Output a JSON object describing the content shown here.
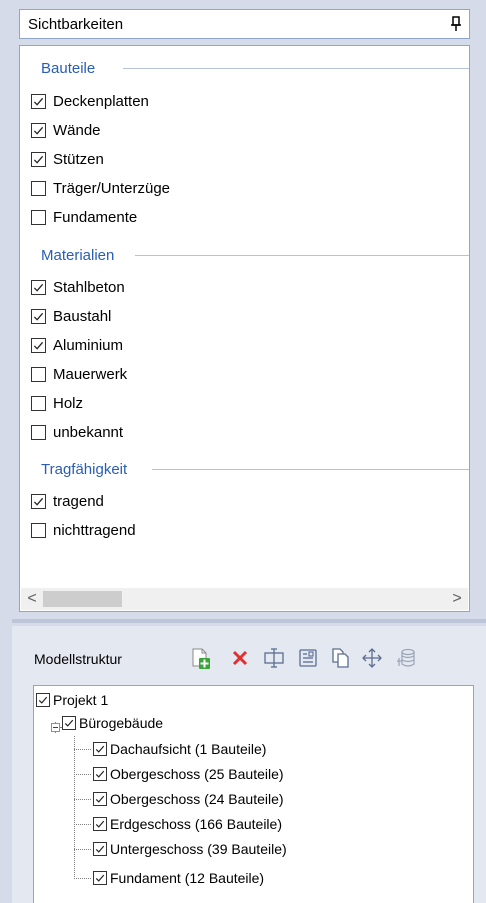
{
  "visibility_panel": {
    "title": "Sichtbarkeiten",
    "pin_icon": "pin-icon",
    "groups": [
      {
        "label": "Bauteile",
        "items": [
          {
            "label": "Deckenplatten",
            "checked": true
          },
          {
            "label": "Wände",
            "checked": true
          },
          {
            "label": "Stützen",
            "checked": true
          },
          {
            "label": "Träger/Unterzüge",
            "checked": false
          },
          {
            "label": "Fundamente",
            "checked": false
          }
        ]
      },
      {
        "label": "Materialien",
        "items": [
          {
            "label": "Stahlbeton",
            "checked": true
          },
          {
            "label": "Baustahl",
            "checked": true
          },
          {
            "label": "Aluminium",
            "checked": true
          },
          {
            "label": "Mauerwerk",
            "checked": false
          },
          {
            "label": "Holz",
            "checked": false
          },
          {
            "label": "unbekannt",
            "checked": false
          }
        ]
      },
      {
        "label": "Tragfähigkeit",
        "items": [
          {
            "label": "tragend",
            "checked": true
          },
          {
            "label": "nichttragend",
            "checked": false
          }
        ]
      }
    ],
    "scrollbar": {
      "left_arrow": "<",
      "right_arrow": ">"
    }
  },
  "model_panel": {
    "title": "Modellstruktur",
    "toolbar_icons": [
      "add-document-icon",
      "delete-icon",
      "split-icon",
      "properties-icon",
      "copy-icon",
      "move-icon",
      "stack-icon"
    ],
    "tree": {
      "root": {
        "label": "Projekt 1",
        "checked": true
      },
      "building": {
        "label": "Bürogebäude",
        "checked": true,
        "expanded": true
      },
      "floors": [
        {
          "label": "Dachaufsicht (1 Bauteile)",
          "checked": true
        },
        {
          "label": "Obergeschoss (25 Bauteile)",
          "checked": true
        },
        {
          "label": "Obergeschoss (24 Bauteile)",
          "checked": true
        },
        {
          "label": "Erdgeschoss (166 Bauteile)",
          "checked": true
        },
        {
          "label": "Untergeschoss (39 Bauteile)",
          "checked": true
        },
        {
          "label": "Fundament (12 Bauteile)",
          "checked": true
        }
      ]
    }
  },
  "colors": {
    "accent": "#2a5db8",
    "panel_border": "#8fa6c9",
    "background": "#d6dbe9"
  }
}
